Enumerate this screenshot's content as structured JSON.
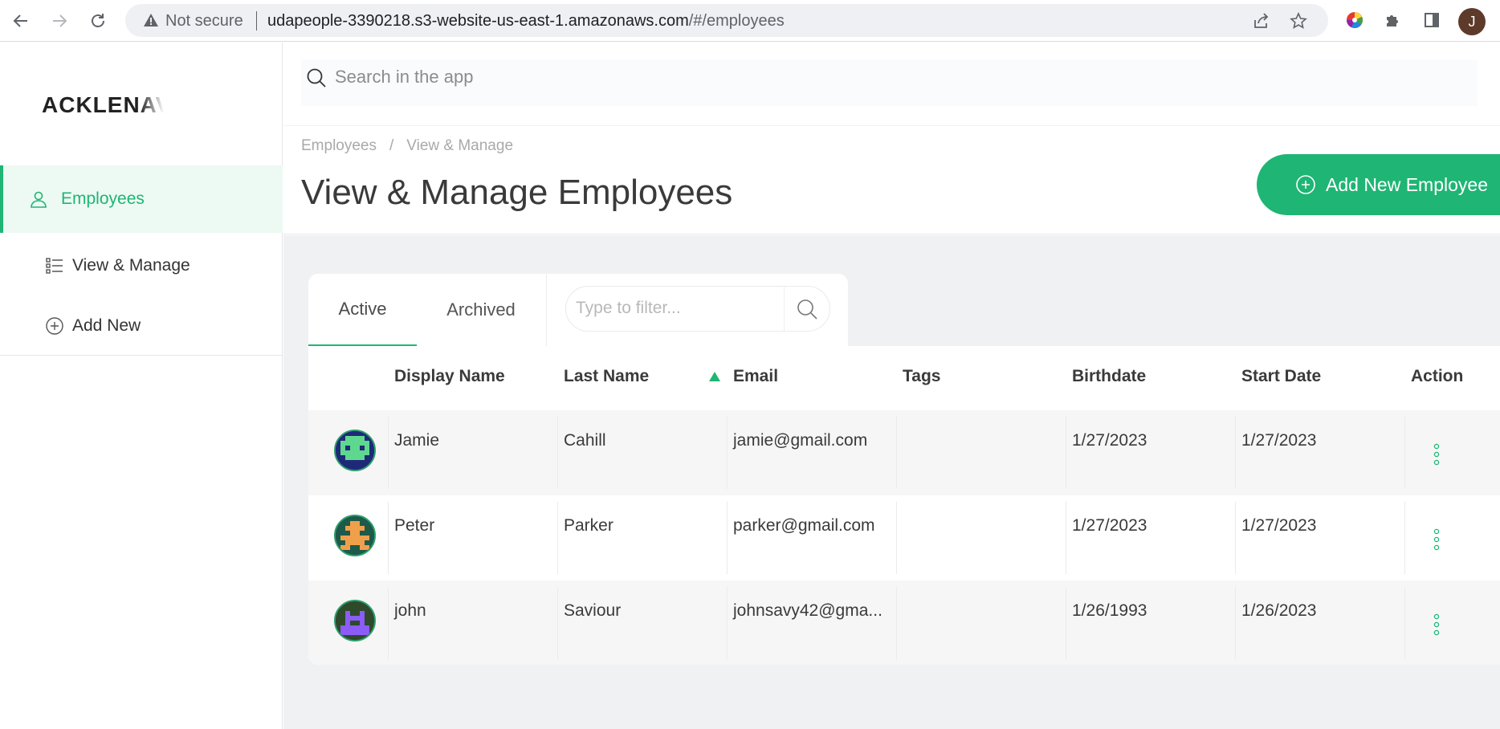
{
  "browser": {
    "security_label": "Not secure",
    "url_host": "udapeople-3390218.s3-website-us-east-1.amazonaws.com",
    "url_path": "/#/employees",
    "profile_initial": "J"
  },
  "sidebar": {
    "logo": "ACKLENAVENUE",
    "items": [
      {
        "label": "Employees",
        "icon": "user-icon",
        "active": true
      },
      {
        "label": "View & Manage",
        "icon": "list-icon",
        "active": false
      },
      {
        "label": "Add New",
        "icon": "plus-circle-icon",
        "active": false
      }
    ]
  },
  "search": {
    "placeholder": "Search in the app"
  },
  "header": {
    "breadcrumb": [
      "Employees",
      "View & Manage"
    ],
    "breadcrumb_sep": "/",
    "title": "View & Manage Employees",
    "add_button": "Add New Employee"
  },
  "tabs": [
    {
      "label": "Active",
      "active": true
    },
    {
      "label": "Archived",
      "active": false
    }
  ],
  "filter": {
    "placeholder": "Type to filter..."
  },
  "table": {
    "columns": [
      "Display Name",
      "Last Name",
      "Email",
      "Tags",
      "Birthdate",
      "Start Date",
      "Action"
    ],
    "sorted_column": "Email",
    "rows": [
      {
        "display_name": "Jamie",
        "last_name": "Cahill",
        "email": "jamie@gmail.com",
        "tags": "",
        "birthdate": "1/27/2023",
        "start_date": "1/27/2023"
      },
      {
        "display_name": "Peter",
        "last_name": "Parker",
        "email": "parker@gmail.com",
        "tags": "",
        "birthdate": "1/27/2023",
        "start_date": "1/27/2023"
      },
      {
        "display_name": "john",
        "last_name": "Saviour",
        "email": "johnsavy42@gma...",
        "tags": "",
        "birthdate": "1/26/1993",
        "start_date": "1/26/2023"
      }
    ]
  },
  "colors": {
    "accent": "#1fb574",
    "content_bg": "#eff1f2"
  }
}
